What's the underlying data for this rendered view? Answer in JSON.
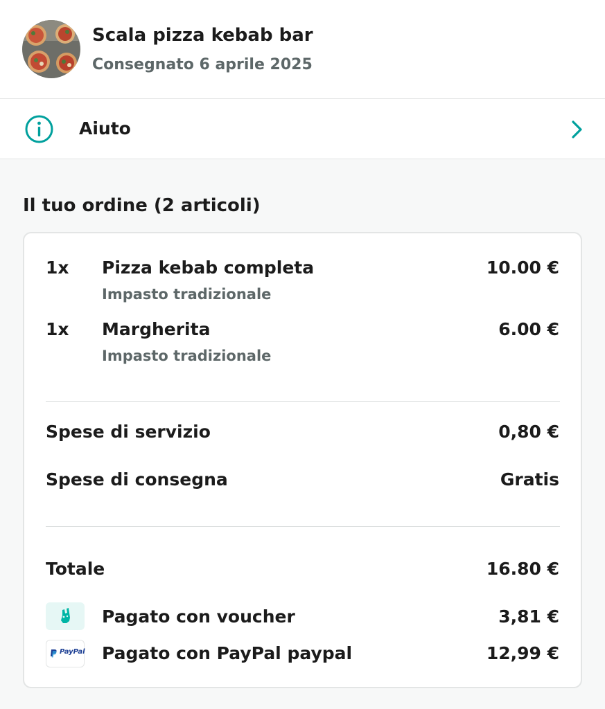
{
  "header": {
    "restaurant_name": "Scala pizza kebab bar",
    "status": "Consegnato 6 aprile 2025",
    "avatar_icon": "pizza-photo"
  },
  "help": {
    "label": "Aiuto",
    "icon": "info-icon",
    "chevron": "chevron-right-icon"
  },
  "order": {
    "title": "Il tuo ordine (2 articoli)",
    "items": [
      {
        "qty": "1x",
        "name": "Pizza kebab completa",
        "option": "Impasto tradizionale",
        "price": "10.00 €"
      },
      {
        "qty": "1x",
        "name": "Margherita",
        "option": "Impasto tradizionale",
        "price": "6.00 €"
      }
    ],
    "fees": [
      {
        "label": "Spese di servizio",
        "value": "0,80 €"
      },
      {
        "label": "Spese di consegna",
        "value": "Gratis"
      }
    ],
    "total": {
      "label": "Totale",
      "value": "16.80 €"
    },
    "payments": [
      {
        "label": "Pagato con voucher",
        "value": "3,81 €",
        "icon": "deliveroo-kangaroo-icon"
      },
      {
        "label": "Pagato con PayPal paypal",
        "value": "12,99 €",
        "icon": "paypal-icon",
        "icon_text": "PayPal"
      }
    ]
  },
  "colors": {
    "accent": "#00a09d",
    "text": "#1b1b1b",
    "muted": "#5d6768",
    "divider": "#e3e5e5",
    "background": "#f7f8f8"
  }
}
